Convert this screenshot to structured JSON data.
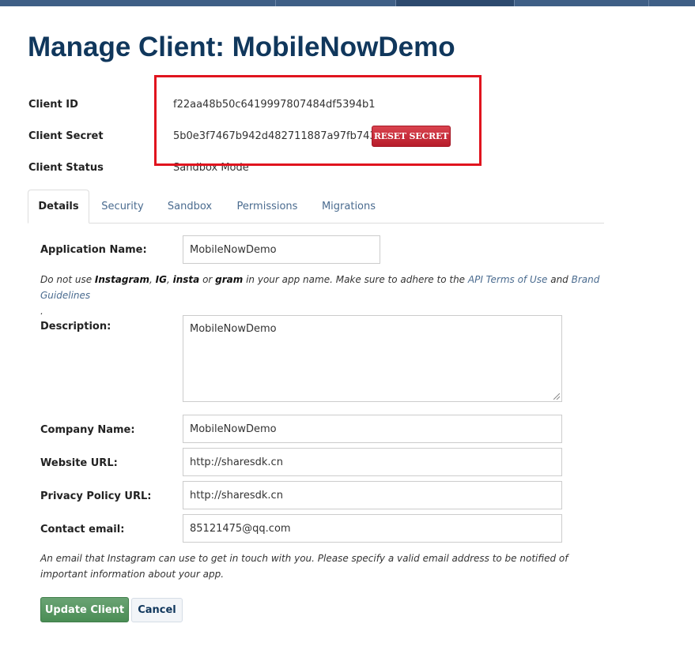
{
  "page": {
    "title": "Manage Client: MobileNowDemo"
  },
  "client_info": {
    "id_label": "Client ID",
    "id_value": "f22aa48b50c6419997807484df5394b1",
    "secret_label": "Client Secret",
    "secret_value": "5b0e3f7467b942d482711887a97fb743",
    "reset_label": "RESET SECRET",
    "status_label": "Client Status",
    "status_value": "Sandbox Mode"
  },
  "tabs": [
    {
      "label": "Details"
    },
    {
      "label": "Security"
    },
    {
      "label": "Sandbox"
    },
    {
      "label": "Permissions"
    },
    {
      "label": "Migrations"
    }
  ],
  "form": {
    "app_name": {
      "label": "Application Name:",
      "value": "MobileNowDemo"
    },
    "name_help": {
      "t1": "Do not use ",
      "b1": "Instagram",
      "t2": ", ",
      "b2": "IG",
      "t3": ", ",
      "b3": "insta",
      "t4": " or ",
      "b4": "gram",
      "t5": " in your app name. Make sure to adhere to the ",
      "link1": "API Terms of Use",
      "t6": " and ",
      "link2": "Brand Guidelines",
      "t7": "."
    },
    "description": {
      "label": "Description:",
      "value": "MobileNowDemo"
    },
    "company": {
      "label": "Company Name:",
      "value": "MobileNowDemo"
    },
    "website": {
      "label": "Website URL:",
      "value": "http://sharesdk.cn"
    },
    "privacy": {
      "label": "Privacy Policy URL:",
      "value": "http://sharesdk.cn"
    },
    "email": {
      "label": "Contact email:",
      "value": "85121475@qq.com"
    },
    "email_help": "An email that Instagram can use to get in touch with you. Please specify a valid email address to be notified of important information about your app.",
    "update_label": "Update Client",
    "cancel_label": "Cancel"
  },
  "colors": {
    "title": "#10375c",
    "accent_link": "#4a6b8f",
    "danger": "#c62a39",
    "success": "#529359",
    "highlight_box": "#e0141e"
  }
}
